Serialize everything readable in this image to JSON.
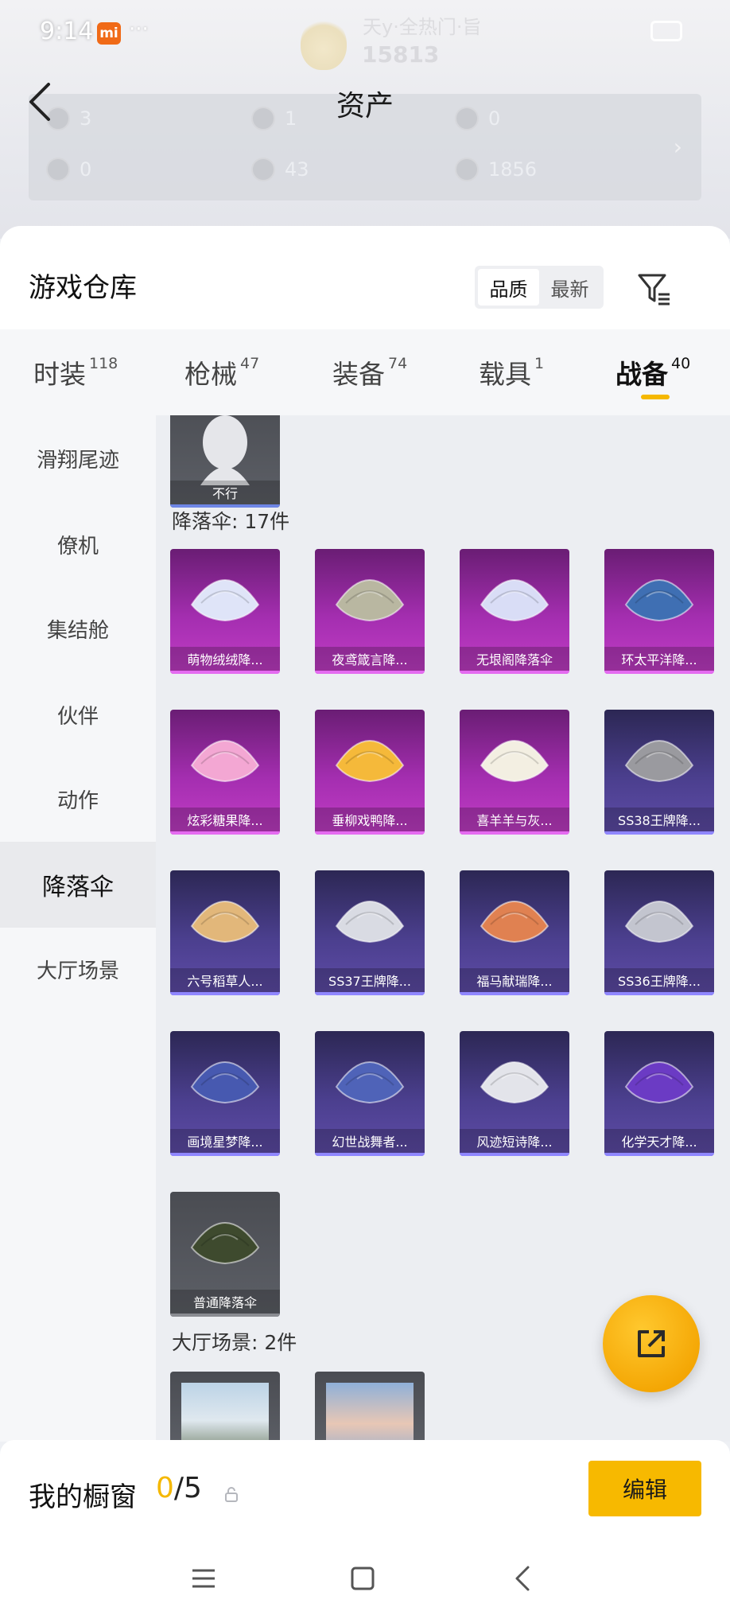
{
  "status_bar": {
    "time": "9:14",
    "mi_badge": "mi",
    "dots": "···"
  },
  "background": {
    "score": "15813",
    "name": "天y·全热门·旨"
  },
  "header": {
    "title": "资产"
  },
  "assets": {
    "row1": [
      {
        "icon": "ticket-icon",
        "value": "3"
      },
      {
        "icon": "coin-icon",
        "value": "1"
      },
      {
        "icon": "badge-coin-icon",
        "value": "0"
      }
    ],
    "row2": [
      {
        "icon": "card-icon",
        "value": "0"
      },
      {
        "icon": "silver-coin-icon",
        "value": "43"
      },
      {
        "icon": "gold-coin-icon",
        "value": "1856"
      }
    ]
  },
  "warehouse": {
    "title": "游戏仓库",
    "sort": {
      "quality": "品质",
      "newest": "最新"
    }
  },
  "tabs": [
    {
      "label": "时装",
      "count": "118"
    },
    {
      "label": "枪械",
      "count": "47"
    },
    {
      "label": "装备",
      "count": "74"
    },
    {
      "label": "载具",
      "count": "1"
    },
    {
      "label": "战备",
      "count": "40"
    }
  ],
  "sidebar": {
    "items": [
      "滑翔尾迹",
      "僚机",
      "集结舱",
      "伙伴",
      "动作",
      "降落伞",
      "大厅场景"
    ]
  },
  "content": {
    "top_card_label": "不行",
    "parachute_section": "降落伞: 17件",
    "parachutes": [
      {
        "name": "萌物绒绒降...",
        "rarity": "purple",
        "color": "#dfe4f8"
      },
      {
        "name": "夜鸢箴言降...",
        "rarity": "purple",
        "color": "#b9b7a1"
      },
      {
        "name": "无垠阁降落伞",
        "rarity": "purple",
        "color": "#d9ddf6"
      },
      {
        "name": "环太平洋降...",
        "rarity": "purple",
        "color": "#3f6fb3"
      },
      {
        "name": "炫彩糖果降...",
        "rarity": "purple",
        "color": "#f3a7d3"
      },
      {
        "name": "垂柳戏鸭降...",
        "rarity": "purple",
        "color": "#f5b93a"
      },
      {
        "name": "喜羊羊与灰...",
        "rarity": "purple",
        "color": "#f3efe2"
      },
      {
        "name": "SS38王牌降...",
        "rarity": "blue",
        "color": "#9a9a9f"
      },
      {
        "name": "六号稻草人...",
        "rarity": "blue",
        "color": "#e2b77a"
      },
      {
        "name": "SS37王牌降...",
        "rarity": "blue",
        "color": "#d9dbe3"
      },
      {
        "name": "福马献瑞降...",
        "rarity": "blue",
        "color": "#e08151"
      },
      {
        "name": "SS36王牌降...",
        "rarity": "blue",
        "color": "#c3c5cf"
      },
      {
        "name": "画境星梦降...",
        "rarity": "blue",
        "color": "#4759b0"
      },
      {
        "name": "幻世战舞者...",
        "rarity": "blue",
        "color": "#4f63b8"
      },
      {
        "name": "风迹短诗降...",
        "rarity": "blue",
        "color": "#e3e4ea"
      },
      {
        "name": "化学天才降...",
        "rarity": "blue",
        "color": "#6b3bc4"
      },
      {
        "name": "普通降落伞",
        "rarity": "grey",
        "color": "#3e4a2e"
      }
    ],
    "scene_section": "大厅场景: 2件"
  },
  "showcase": {
    "label": "我的橱窗",
    "current": "0",
    "total": "/5",
    "edit": "编辑"
  },
  "colors": {
    "accent": "#f5b800",
    "purple_rarity": "#c23dc6",
    "blue_rarity": "#5f4ca8"
  }
}
